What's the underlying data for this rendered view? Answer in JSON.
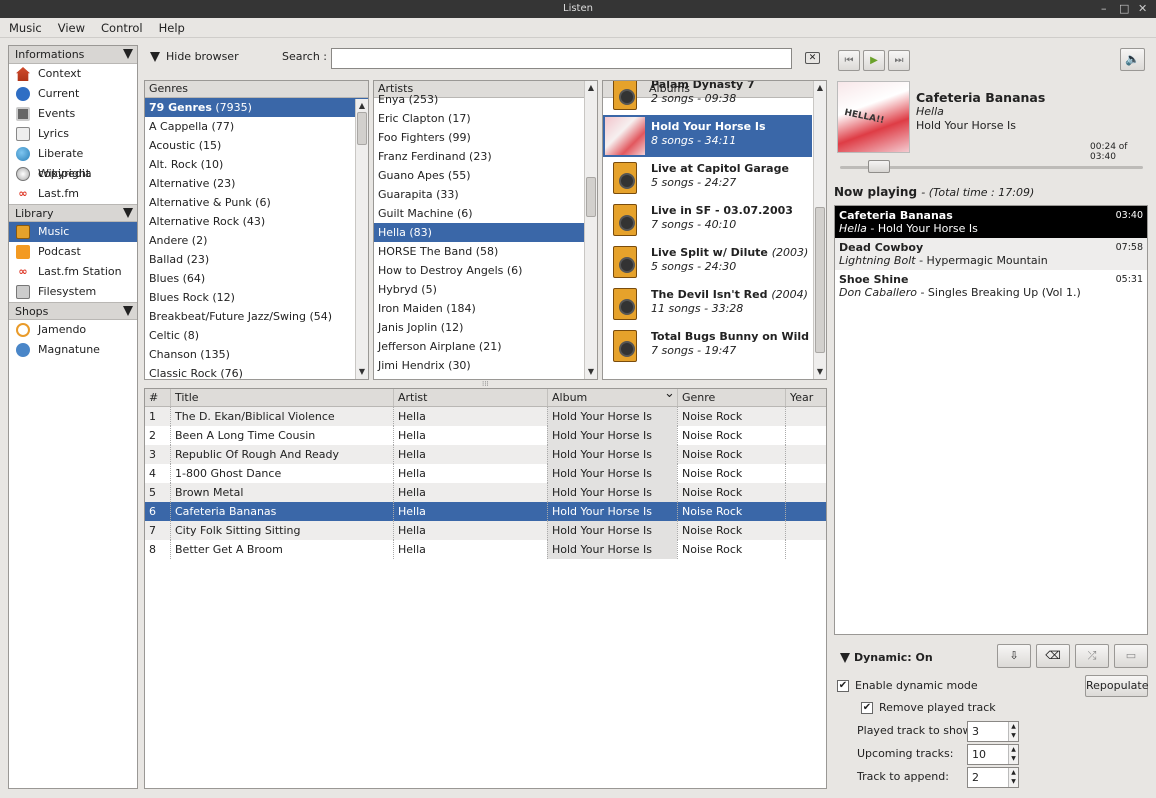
{
  "window": {
    "title": "Listen"
  },
  "menu": [
    "Music",
    "View",
    "Control",
    "Help"
  ],
  "sidebar": {
    "sections": [
      {
        "label": "Informations",
        "items": [
          {
            "label": "Context",
            "icon": "home-icon"
          },
          {
            "label": "Current",
            "icon": "info-icon"
          },
          {
            "label": "Events",
            "icon": "events-icon"
          },
          {
            "label": "Lyrics",
            "icon": "lyrics-icon"
          },
          {
            "label": "Liberate copyright",
            "icon": "globe-icon"
          },
          {
            "label": "Wikipedia",
            "icon": "wikipedia-icon"
          },
          {
            "label": "Last.fm",
            "icon": "lastfm-icon"
          }
        ]
      },
      {
        "label": "Library",
        "items": [
          {
            "label": "Music",
            "icon": "speaker-icon",
            "selected": true
          },
          {
            "label": "Podcast",
            "icon": "rss-icon"
          },
          {
            "label": "Last.fm Station",
            "icon": "lastfm-icon"
          },
          {
            "label": "Filesystem",
            "icon": "filesystem-icon"
          }
        ]
      },
      {
        "label": "Shops",
        "items": [
          {
            "label": "Jamendo",
            "icon": "jamendo-icon"
          },
          {
            "label": "Magnatune",
            "icon": "magnatune-icon"
          }
        ]
      }
    ]
  },
  "browser": {
    "hide_label": "Hide browser",
    "search_label": "Search :",
    "search_value": "",
    "genres": {
      "header": "Genres",
      "all_label": "79 Genres",
      "all_count": "(7935)",
      "items": [
        "A Cappella (77)",
        "Acoustic (15)",
        "Alt. Rock (10)",
        "Alternative (23)",
        "Alternative & Punk (6)",
        "Alternative Rock (43)",
        "Andere (2)",
        "Ballad (23)",
        "Blues (64)",
        "Blues Rock (12)",
        "Breakbeat/Future Jazz/Swing (54)",
        "Celtic (8)",
        "Chanson (135)",
        "Classic Rock (76)"
      ]
    },
    "artists": {
      "header": "Artists",
      "selected_index": 7,
      "items": [
        "Enya (253)",
        "Eric Clapton (17)",
        "Foo Fighters (99)",
        "Franz Ferdinand (23)",
        "Guano Apes (55)",
        "Guarapita (33)",
        "Guilt Machine (6)",
        "Hella (83)",
        "HORSE The Band (58)",
        "How to Destroy Angels (6)",
        "Hybryd (5)",
        "Iron Maiden (184)",
        "Janis Joplin (12)",
        "Jefferson Airplane (21)",
        "Jimi Hendrix (30)"
      ]
    },
    "albums": {
      "header": "Albums",
      "items": [
        {
          "title": "Palam Dynasty 7",
          "year": "",
          "sub": "2 songs - 09:38",
          "cover": "speaker"
        },
        {
          "title": "Hold Your Horse Is",
          "year": "",
          "sub": "8 songs - 34:11",
          "cover": "art",
          "selected": true
        },
        {
          "title": "Live at Capitol Garage",
          "year": "",
          "sub": "5 songs - 24:27",
          "cover": "speaker"
        },
        {
          "title": "Live in SF - 03.07.2003",
          "year": "",
          "sub": "7 songs - 40:10",
          "cover": "speaker"
        },
        {
          "title": "Live Split w/ Dilute",
          "year": "(2003)",
          "sub": "5 songs - 24:30",
          "cover": "speaker"
        },
        {
          "title": "The Devil Isn't Red",
          "year": "(2004)",
          "sub": "11 songs - 33:28",
          "cover": "speaker"
        },
        {
          "title": "Total Bugs Bunny on Wild Bass",
          "year": "",
          "sub": "7 songs - 19:47",
          "cover": "speaker"
        }
      ]
    }
  },
  "tracks": {
    "columns": [
      "#",
      "Title",
      "Artist",
      "Album",
      "Genre",
      "Year"
    ],
    "rows": [
      {
        "n": "1",
        "title": "The D. Ekan/Biblical Violence",
        "artist": "Hella",
        "album": "Hold Your Horse Is",
        "genre": "Noise Rock",
        "year": ""
      },
      {
        "n": "2",
        "title": "Been A Long Time Cousin",
        "artist": "Hella",
        "album": "Hold Your Horse Is",
        "genre": "Noise Rock",
        "year": ""
      },
      {
        "n": "3",
        "title": "Republic Of Rough And Ready",
        "artist": "Hella",
        "album": "Hold Your Horse Is",
        "genre": "Noise Rock",
        "year": ""
      },
      {
        "n": "4",
        "title": "1-800 Ghost Dance",
        "artist": "Hella",
        "album": "Hold Your Horse Is",
        "genre": "Noise Rock",
        "year": ""
      },
      {
        "n": "5",
        "title": "Brown Metal",
        "artist": "Hella",
        "album": "Hold Your Horse Is",
        "genre": "Noise Rock",
        "year": ""
      },
      {
        "n": "6",
        "title": "Cafeteria Bananas",
        "artist": "Hella",
        "album": "Hold Your Horse Is",
        "genre": "Noise Rock",
        "year": "",
        "selected": true
      },
      {
        "n": "7",
        "title": "City Folk Sitting Sitting",
        "artist": "Hella",
        "album": "Hold Your Horse Is",
        "genre": "Noise Rock",
        "year": ""
      },
      {
        "n": "8",
        "title": "Better Get A Broom",
        "artist": "Hella",
        "album": "Hold Your Horse Is",
        "genre": "Noise Rock",
        "year": ""
      }
    ]
  },
  "player": {
    "title": "Cafeteria Bananas",
    "artist": "Hella",
    "album": "Hold Your Horse Is",
    "time": "00:24 of 03:40",
    "progress_fraction": 0.11,
    "cover_text": "HELLA!!"
  },
  "nowplaying": {
    "label": "Now playing",
    "total": "(Total time : 17:09)",
    "items": [
      {
        "title": "Cafeteria Bananas",
        "artist": "Hella",
        "album": "Hold Your Horse Is",
        "duration": "03:40",
        "playing": true
      },
      {
        "title": "Dead Cowboy",
        "artist": "Lightning Bolt",
        "album": "Hypermagic Mountain",
        "duration": "07:58"
      },
      {
        "title": "Shoe Shine",
        "artist": "Don Caballero",
        "album": "Singles Breaking Up (Vol 1.)",
        "duration": "05:31"
      }
    ]
  },
  "dynamic": {
    "label": "Dynamic: On",
    "enable_label": "Enable dynamic mode",
    "enable_checked": true,
    "remove_label": "Remove played track",
    "remove_checked": true,
    "repopulate_label": "Repopulate",
    "played_label": "Played track to show:",
    "played_value": "3",
    "upcoming_label": "Upcoming tracks:",
    "upcoming_value": "10",
    "append_label": "Track to append:",
    "append_value": "2"
  },
  "colors": {
    "selection": "#3a67a8",
    "playing_bg": "#000000",
    "play_green": "#8fc93a"
  }
}
